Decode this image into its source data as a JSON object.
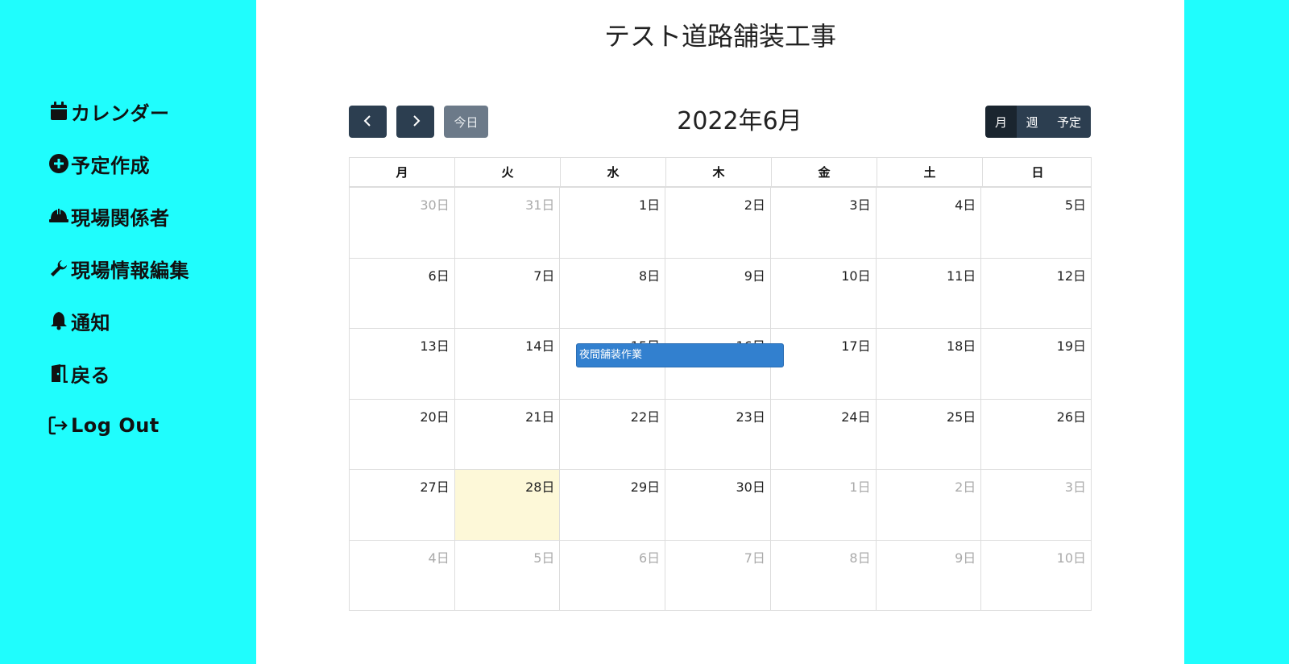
{
  "sidebar": {
    "items": [
      {
        "label": "カレンダー",
        "icon": "calendar-icon"
      },
      {
        "label": "予定作成",
        "icon": "plus-circle-icon"
      },
      {
        "label": "現場関係者",
        "icon": "hard-hat-icon"
      },
      {
        "label": "現場情報編集",
        "icon": "wrench-icon"
      },
      {
        "label": "通知",
        "icon": "bell-icon"
      },
      {
        "label": "戻る",
        "icon": "door-open-icon"
      },
      {
        "label": "Log Out",
        "icon": "sign-out-icon"
      }
    ]
  },
  "page": {
    "title": "テスト道路舗装工事"
  },
  "toolbar": {
    "today_label": "今日",
    "calendar_title": "2022年6月",
    "views": [
      "月",
      "週",
      "予定"
    ]
  },
  "calendar": {
    "weekdays": [
      "月",
      "火",
      "水",
      "木",
      "金",
      "土",
      "日"
    ],
    "weeks": [
      [
        "30日",
        "31日",
        "1日",
        "2日",
        "3日",
        "4日",
        "5日"
      ],
      [
        "6日",
        "7日",
        "8日",
        "9日",
        "10日",
        "11日",
        "12日"
      ],
      [
        "13日",
        "14日",
        "15日",
        "16日",
        "17日",
        "18日",
        "19日"
      ],
      [
        "20日",
        "21日",
        "22日",
        "23日",
        "24日",
        "25日",
        "26日"
      ],
      [
        "27日",
        "28日",
        "29日",
        "30日",
        "1日",
        "2日",
        "3日"
      ],
      [
        "4日",
        "5日",
        "6日",
        "7日",
        "8日",
        "9日",
        "10日"
      ]
    ],
    "event": {
      "title": "夜間舗装作業"
    }
  },
  "colors": {
    "sidebar_bg": "#1ffdfd",
    "button_dark": "#2c3e50",
    "today_highlight": "#fdf8d8",
    "event_blue": "#3280cf"
  }
}
